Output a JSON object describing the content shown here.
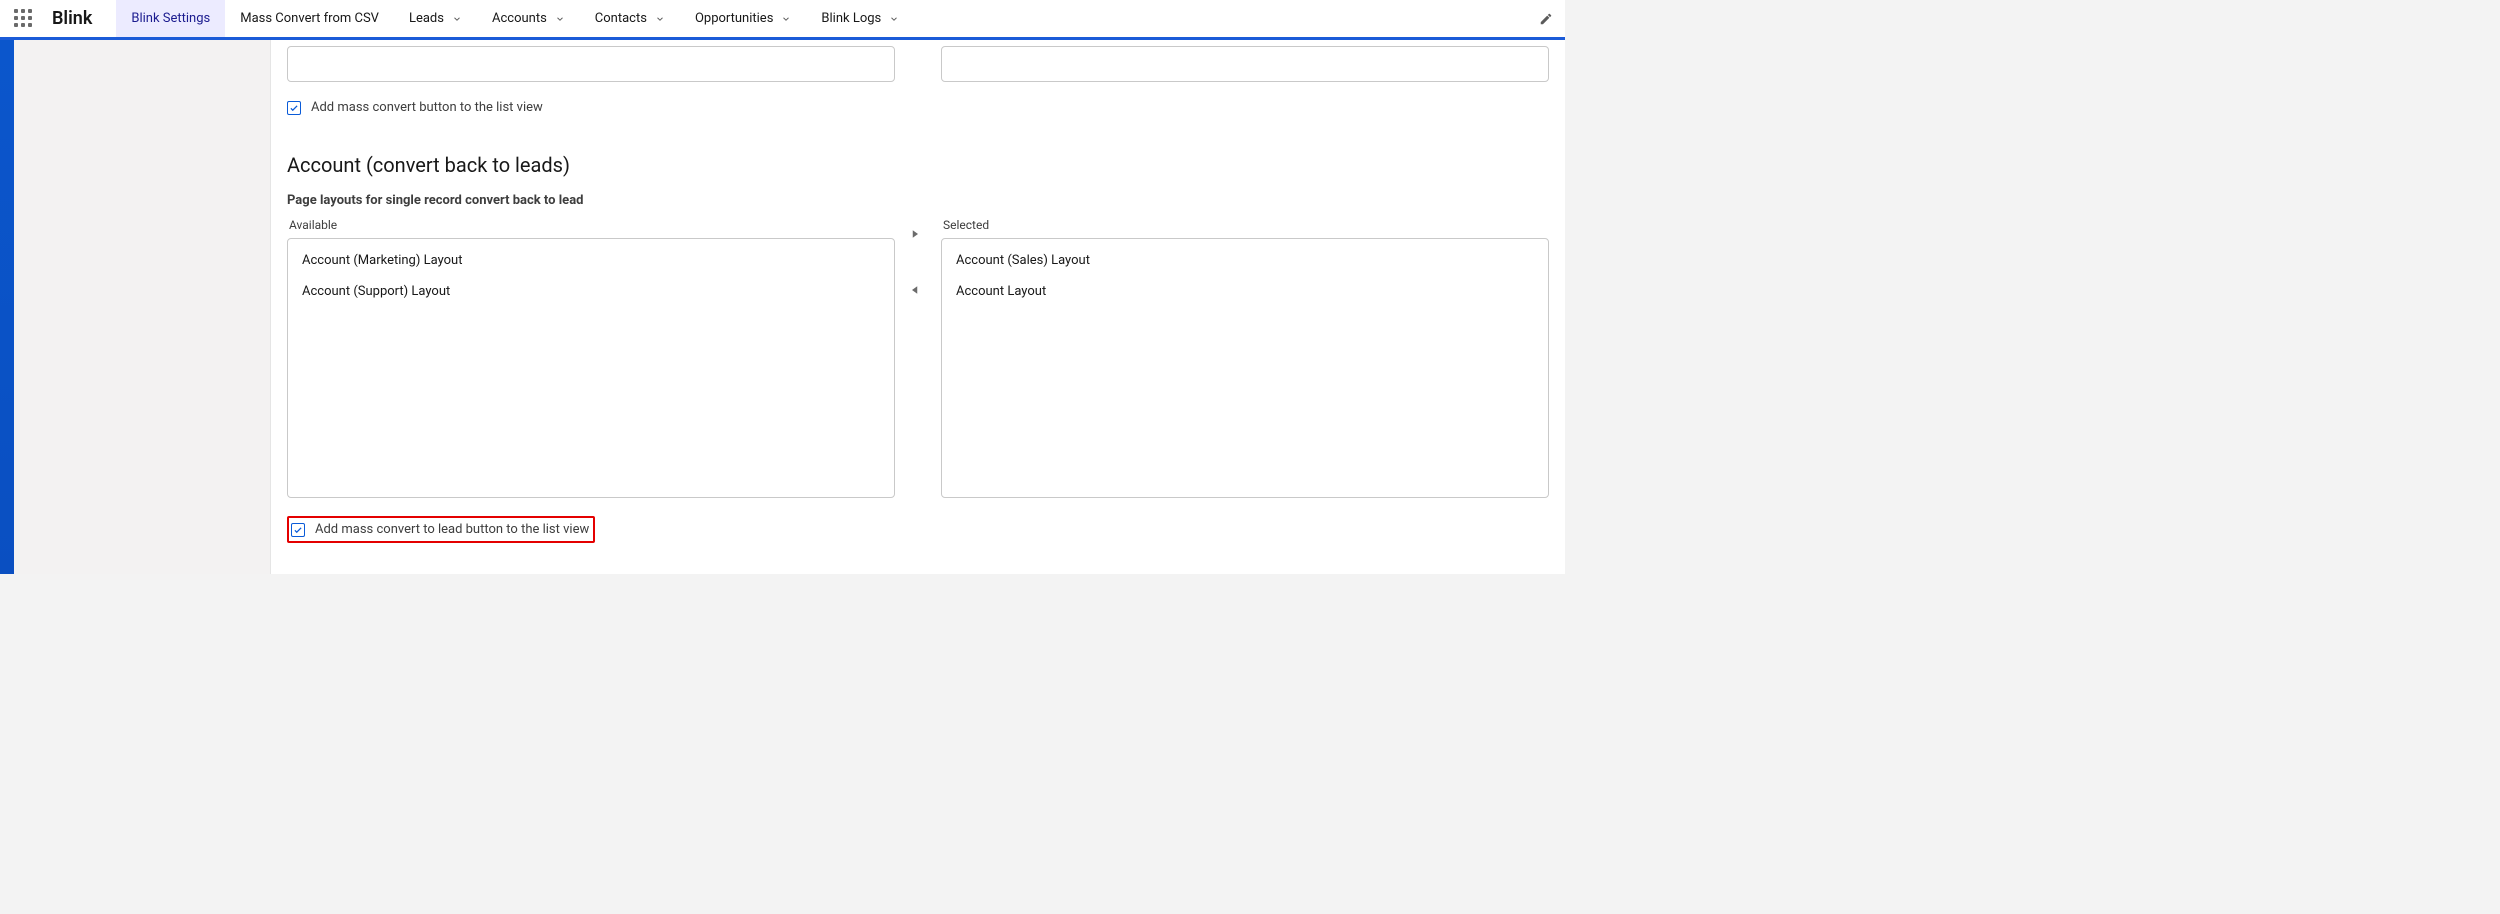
{
  "app": {
    "name": "Blink"
  },
  "nav": {
    "tabs": [
      {
        "label": "Blink Settings",
        "has_chevron": false,
        "active": true
      },
      {
        "label": "Mass Convert from CSV",
        "has_chevron": false,
        "active": false
      },
      {
        "label": "Leads",
        "has_chevron": true,
        "active": false
      },
      {
        "label": "Accounts",
        "has_chevron": true,
        "active": false
      },
      {
        "label": "Contacts",
        "has_chevron": true,
        "active": false
      },
      {
        "label": "Opportunities",
        "has_chevron": true,
        "active": false
      },
      {
        "label": "Blink Logs",
        "has_chevron": true,
        "active": false
      }
    ]
  },
  "top_section": {
    "checkbox_label": "Add mass convert button to the list view",
    "checkbox_checked": true
  },
  "account_section": {
    "heading": "Account (convert back to leads)",
    "subheading": "Page layouts for single record convert back to lead",
    "available_label": "Available",
    "selected_label": "Selected",
    "available_items": [
      "Account (Marketing) Layout",
      "Account (Support) Layout"
    ],
    "selected_items": [
      "Account (Sales) Layout",
      "Account Layout"
    ],
    "checkbox_label": "Add mass convert to lead button to the list view",
    "checkbox_checked": true
  }
}
